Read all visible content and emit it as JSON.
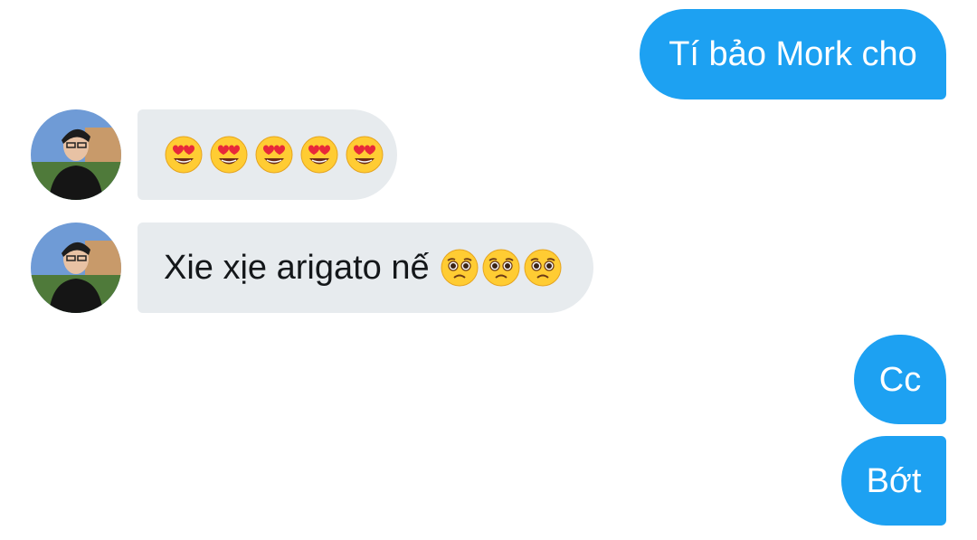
{
  "messages": [
    {
      "sender": "me",
      "text": "Tí bảo Mork cho"
    },
    {
      "sender": "contact",
      "emojis": [
        "heart-eyes",
        "heart-eyes",
        "heart-eyes",
        "heart-eyes",
        "heart-eyes"
      ]
    },
    {
      "sender": "contact",
      "text": "Xie xịe arigato nế",
      "emojis": [
        "pleading-face",
        "pleading-face",
        "pleading-face"
      ]
    },
    {
      "sender": "me",
      "text": "Cc"
    },
    {
      "sender": "me",
      "text": "Bớt"
    }
  ],
  "colors": {
    "outgoing_bubble": "#1da1f2",
    "incoming_bubble": "#e7ebee",
    "outgoing_text": "#ffffff",
    "incoming_text": "#14171a"
  }
}
